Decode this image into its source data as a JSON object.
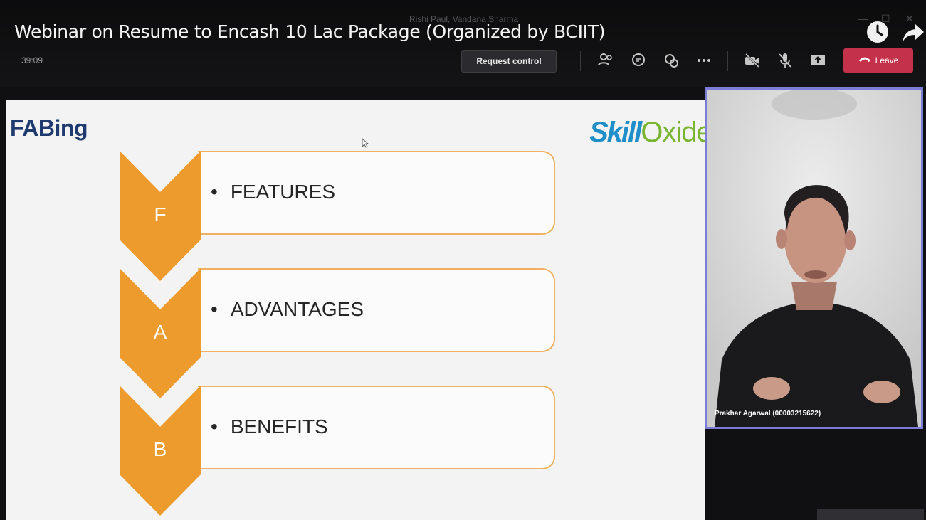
{
  "video": {
    "title": "Webinar on Resume to Encash 10 Lac Package (Organized by BCIIT)",
    "caller_names": "Rishi Paul, Vandana Sharma"
  },
  "meeting": {
    "timer": "39:09",
    "request_control_label": "Request control",
    "leave_label": "Leave",
    "icons": [
      "participants-icon",
      "chat-icon",
      "reactions-icon",
      "more-icon",
      "camera-off-icon",
      "mic-off-icon",
      "share-icon",
      "phone-icon"
    ],
    "accent_color": "#c4314b"
  },
  "slide": {
    "title": "FABing",
    "brand_part1": "Skill",
    "brand_part2": "Oxide",
    "items": [
      {
        "letter": "F",
        "text": "FEATURES"
      },
      {
        "letter": "A",
        "text": "ADVANTAGES"
      },
      {
        "letter": "B",
        "text": "BENEFITS"
      }
    ],
    "chevron_color": "#ec9b2c",
    "box_border_color": "#f0b260"
  },
  "participant": {
    "name": "Prakhar Agarwal (00003215622)"
  }
}
